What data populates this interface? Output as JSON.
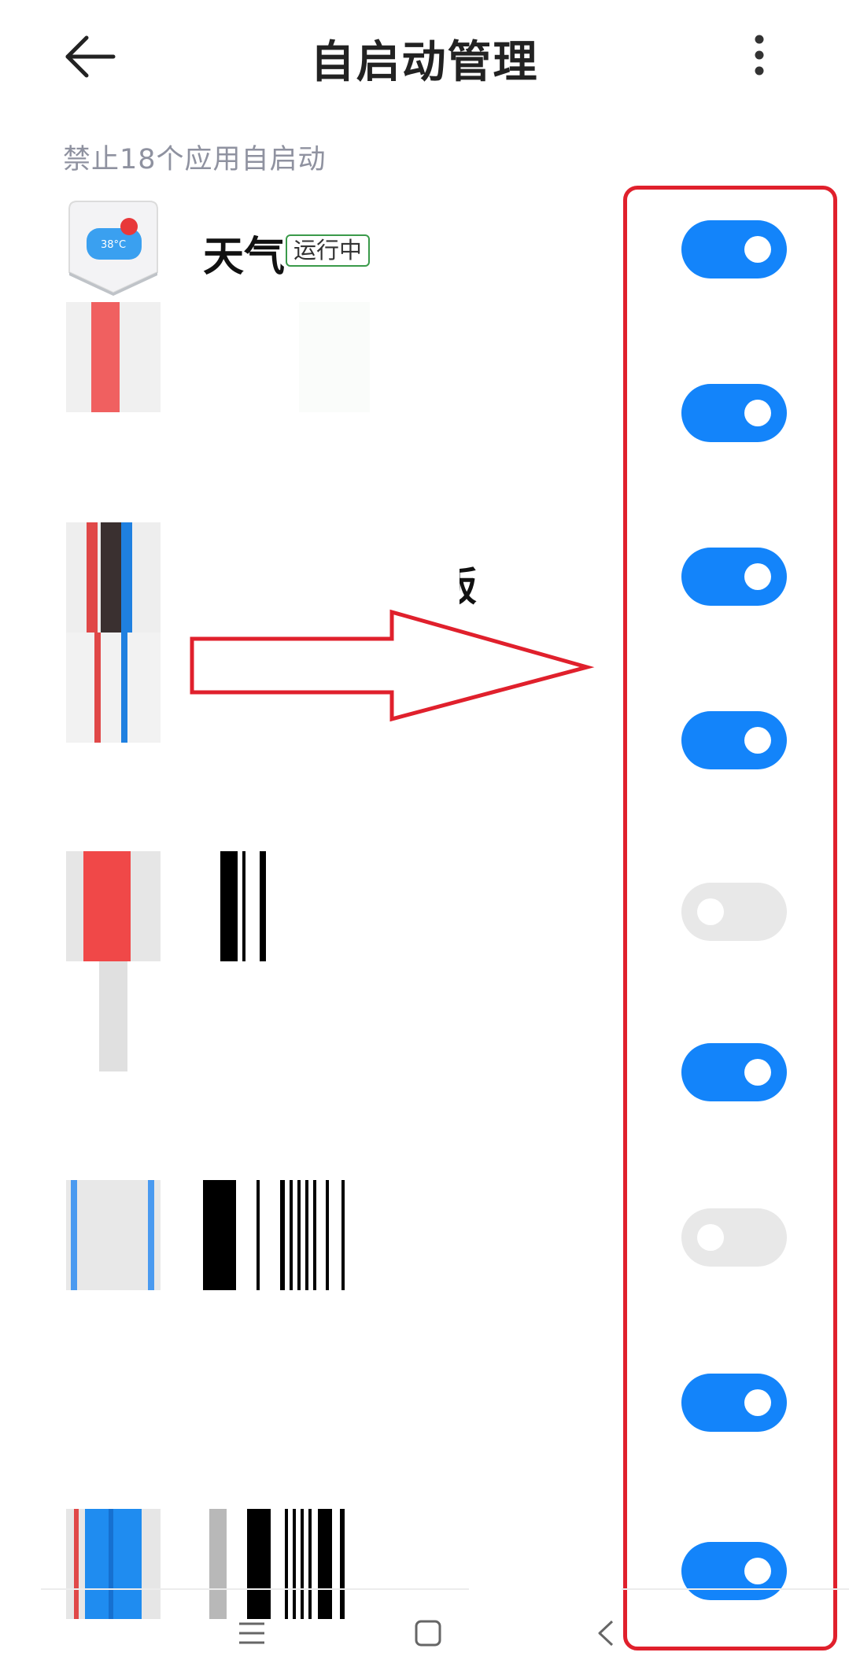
{
  "header": {
    "title": "自启动管理",
    "back_icon": "arrow-left-icon",
    "more_icon": "more-vertical-icon"
  },
  "subtitle": "禁止18个应用自启动",
  "apps": [
    {
      "name": "天气",
      "badge": "运行中",
      "enabled": true
    },
    {
      "name": "",
      "badge": "",
      "enabled": true
    },
    {
      "name": "版",
      "badge": "",
      "enabled": true
    },
    {
      "name": "",
      "badge": "",
      "enabled": true
    },
    {
      "name": "",
      "badge": "",
      "enabled": false
    },
    {
      "name": "",
      "badge": "",
      "enabled": true
    },
    {
      "name": "",
      "badge": "",
      "enabled": false
    },
    {
      "name": "",
      "badge": "",
      "enabled": true
    },
    {
      "name": "",
      "badge": "",
      "enabled": true
    }
  ],
  "nav": {
    "menu_icon": "menu-icon",
    "home_icon": "square-home-icon",
    "back_icon": "chevron-left-icon"
  },
  "colors": {
    "toggle_on": "#1384fa",
    "toggle_off": "#e8e8e8",
    "annotation_red": "#e0202c"
  }
}
